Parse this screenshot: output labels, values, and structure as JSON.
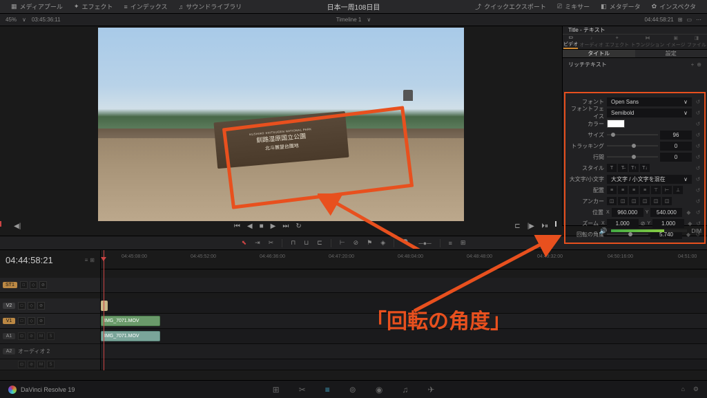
{
  "topbar": {
    "mediapool": "メディアプール",
    "effects": "エフェクト",
    "index": "インデックス",
    "soundlib": "サウンドライブラリ",
    "title": "日本一周108日目",
    "quickexport": "クイックエクスポート",
    "mixer": "ミキサー",
    "metadata": "メタデータ",
    "inspector": "インスペクタ"
  },
  "subbar": {
    "zoom": "45%",
    "tc_left": "03:45:36:11",
    "timeline": "Timeline 1",
    "tc_right": "04:44:58:21"
  },
  "viewer": {
    "sign_small": "KUSHIRO SHITSUGEN NATIONAL PARK",
    "sign_line1": "釧路湿原国立公園",
    "sign_line2": "北斗展望台園地"
  },
  "inspector_panel": {
    "title": "Title - テキスト",
    "tab_video": "ビデオ",
    "tab_audio": "オーディオ",
    "tab_effects": "エフェクト",
    "tab_trans": "トランジション",
    "tab_image": "イメージ",
    "tab_file": "ファイル",
    "subtab_title": "タイトル",
    "subtab_settings": "設定",
    "section": "リッチテキスト"
  },
  "props": {
    "font_label": "フォント",
    "font_value": "Open Sans",
    "fontface_label": "フォントフェイス",
    "fontface_value": "Semibold",
    "color_label": "カラー",
    "size_label": "サイズ",
    "size_value": "96",
    "tracking_label": "トラッキング",
    "tracking_value": "0",
    "linesp_label": "行間",
    "linesp_value": "0",
    "style_label": "スタイル",
    "case_label": "大文字/小文字",
    "case_value": "大文字 / 小文字を混在",
    "align_label": "配置",
    "anchor_label": "アンカー",
    "position_label": "位置",
    "position_x": "960.000",
    "position_y": "540.000",
    "zoom_label": "ズーム",
    "zoom_x": "1.000",
    "zoom_y": "1.000",
    "rotation_label": "回転の角度",
    "rotation_value": "5.740",
    "x": "X",
    "y": "Y"
  },
  "audio_meter": {
    "dim": "DIM"
  },
  "timeline": {
    "tc": "04:44:58:21",
    "ticks": [
      "04:45:08:00",
      "04:45:52:00",
      "04:46:36:00",
      "04:47:20:00",
      "04:48:04:00",
      "04:48:48:00",
      "04:49:32:00",
      "04:50:16:00",
      "04:51:00"
    ],
    "tracks": {
      "st1": "ST1",
      "v2": "V2",
      "v1": "V1",
      "a1": "A1",
      "a2": "A2",
      "a2_label": "オーディオ 2"
    },
    "clip1": "IMG_7071.MOV",
    "clip2": "IMG_7071.MOV",
    "mute": "M",
    "solo": "S"
  },
  "annotation": {
    "text": "「回転の角度」"
  },
  "bottombar": {
    "app": "DaVinci Resolve 19"
  }
}
